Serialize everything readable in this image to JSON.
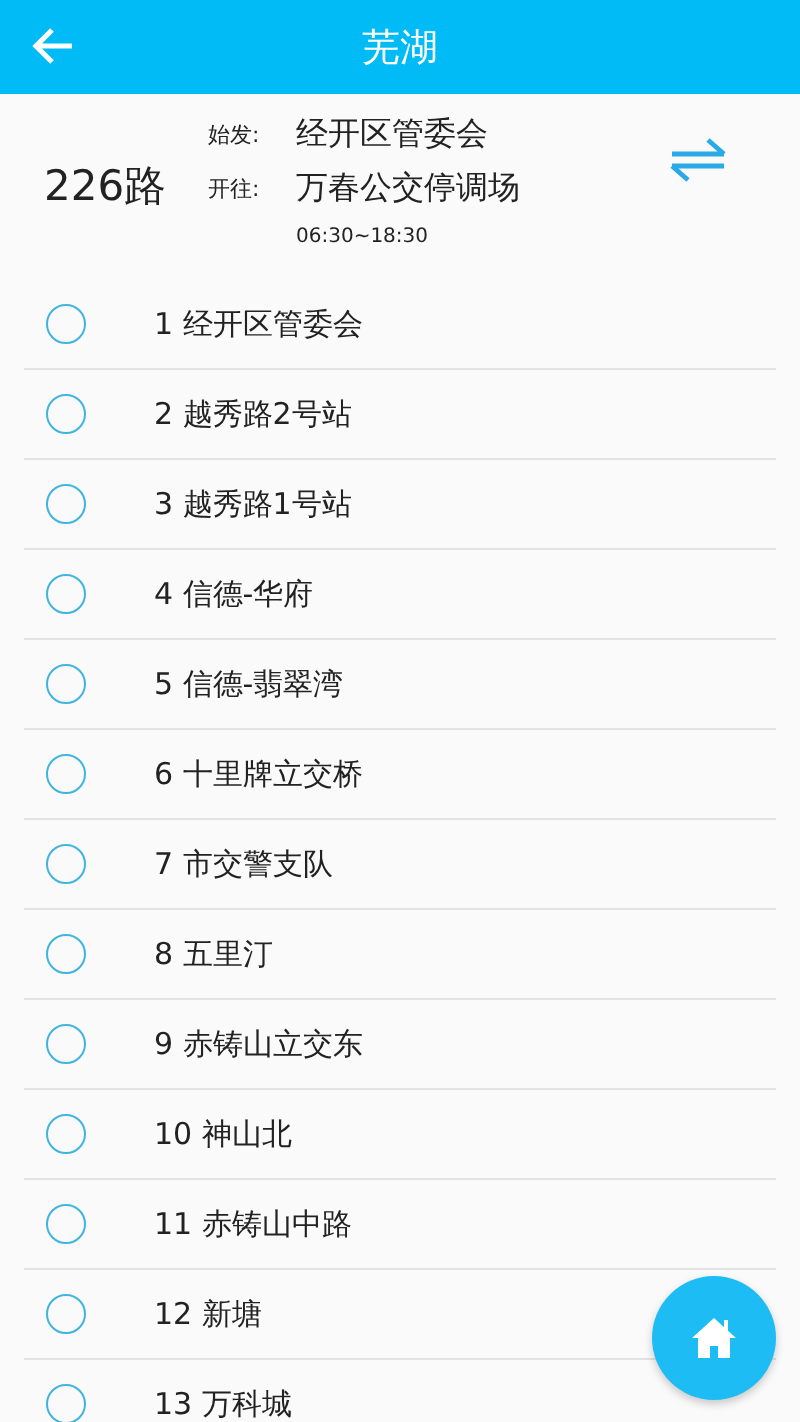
{
  "header": {
    "title": "芜湖"
  },
  "route": {
    "name": "226路",
    "from_label": "始发:",
    "from": "经开区管委会",
    "to_label": "开往:",
    "to": "万春公交停调场",
    "hours": "06:30~18:30"
  },
  "stops": [
    {
      "label": "1 经开区管委会"
    },
    {
      "label": "2 越秀路2号站"
    },
    {
      "label": "3 越秀路1号站"
    },
    {
      "label": "4 信德-华府"
    },
    {
      "label": "5 信德-翡翠湾"
    },
    {
      "label": "6 十里牌立交桥"
    },
    {
      "label": "7 市交警支队"
    },
    {
      "label": "8 五里汀"
    },
    {
      "label": "9 赤铸山立交东"
    },
    {
      "label": "10 神山北"
    },
    {
      "label": "11 赤铸山中路"
    },
    {
      "label": "12 新塘"
    },
    {
      "label": "13 万科城"
    }
  ]
}
